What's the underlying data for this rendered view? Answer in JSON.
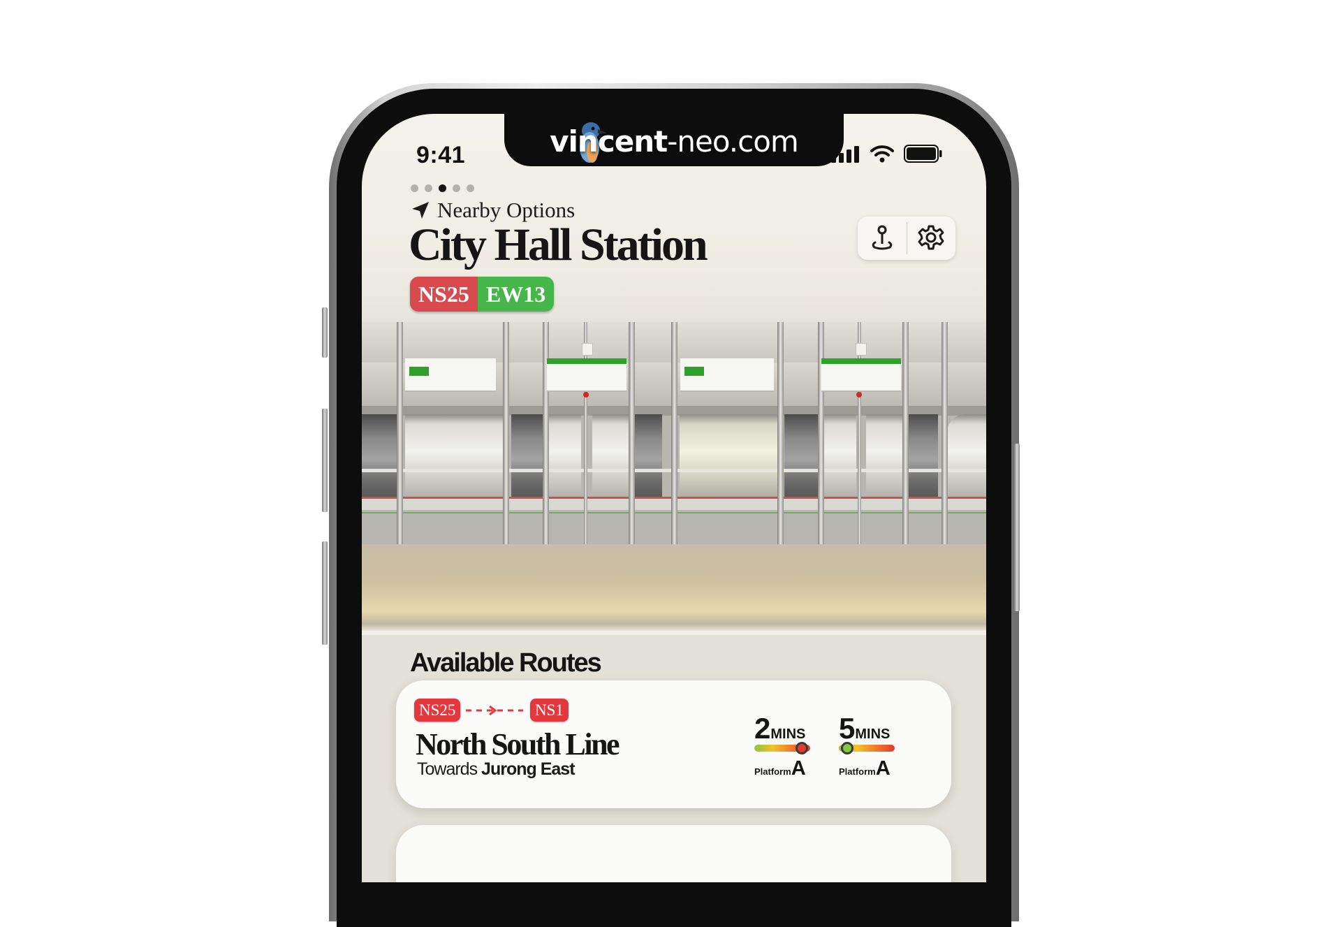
{
  "watermark": {
    "brand_bold": "vincent",
    "brand_rest": "-neo.com"
  },
  "status_bar": {
    "time": "9:41"
  },
  "page_indicator": {
    "count": 5,
    "active_index": 2
  },
  "header": {
    "nearby_label": "Nearby Options",
    "station_name": "City Hall Station",
    "station_codes": [
      {
        "code": "NS25",
        "color": "#d94a4f"
      },
      {
        "code": "EW13",
        "color": "#46b64a"
      }
    ]
  },
  "toolbar": {
    "icons": [
      "map-pin-icon",
      "gear-icon"
    ]
  },
  "routes_section": {
    "title": "Available Routes",
    "routes": [
      {
        "from_code": "NS25",
        "to_code": "NS1",
        "line_name": "North South Line",
        "towards_prefix": "Towards",
        "destination": "Jurong East",
        "line_color": "#e2383e",
        "arrivals": [
          {
            "minutes": "2",
            "unit": "MINS",
            "platform_label": "Platform",
            "platform": "A",
            "crowd_level": 0.85
          },
          {
            "minutes": "5",
            "unit": "MINS",
            "platform_label": "Platform",
            "platform": "A",
            "crowd_level": 0.15
          }
        ]
      }
    ]
  }
}
